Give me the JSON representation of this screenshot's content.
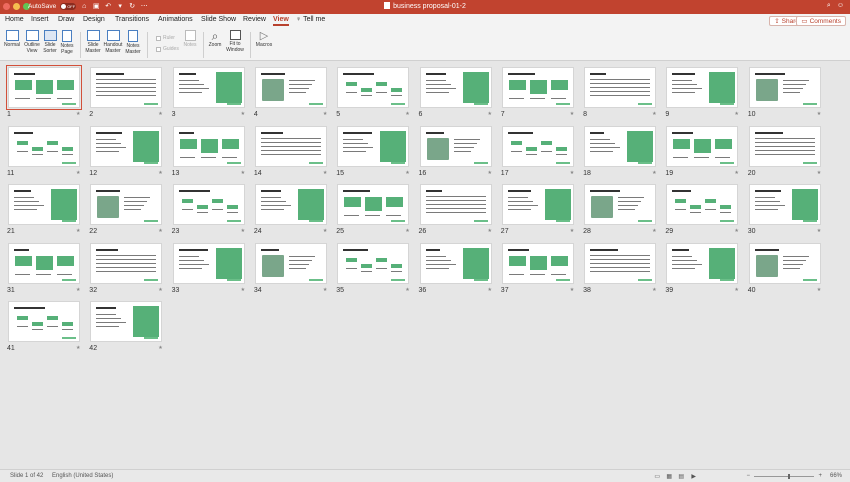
{
  "titlebar": {
    "autosave_label": "AutoSave",
    "autosave_state": "OFF",
    "document_title": "business proposal-01-2"
  },
  "tabs": [
    "Home",
    "Insert",
    "Draw",
    "Design",
    "Transitions",
    "Animations",
    "Slide Show",
    "Review",
    "View"
  ],
  "active_tab": "View",
  "tell_me": "Tell me",
  "share": "Share",
  "comments": "Comments",
  "ribbon": {
    "normal": "Normal",
    "outline_view": [
      "Outline",
      "View"
    ],
    "slide_sorter": [
      "Slide",
      "Sorter"
    ],
    "notes_page": [
      "Notes",
      "Page"
    ],
    "slide_master": [
      "Slide",
      "Master"
    ],
    "handout_master": [
      "Handout",
      "Master"
    ],
    "notes_master": [
      "Notes",
      "Master"
    ],
    "ruler": "Ruler",
    "guides": "Guides",
    "notes": "Notes",
    "zoom": "Zoom",
    "fit_to_window": [
      "Fit to",
      "Window"
    ],
    "macros": "Macros"
  },
  "slides": {
    "count": 42,
    "selected": 1
  },
  "status": {
    "slide_position": "Slide 1 of 42",
    "language": "English (United States)",
    "zoom_level": "66%"
  },
  "colors": {
    "accent": "#c1432f",
    "slide_green": "#56b078"
  }
}
